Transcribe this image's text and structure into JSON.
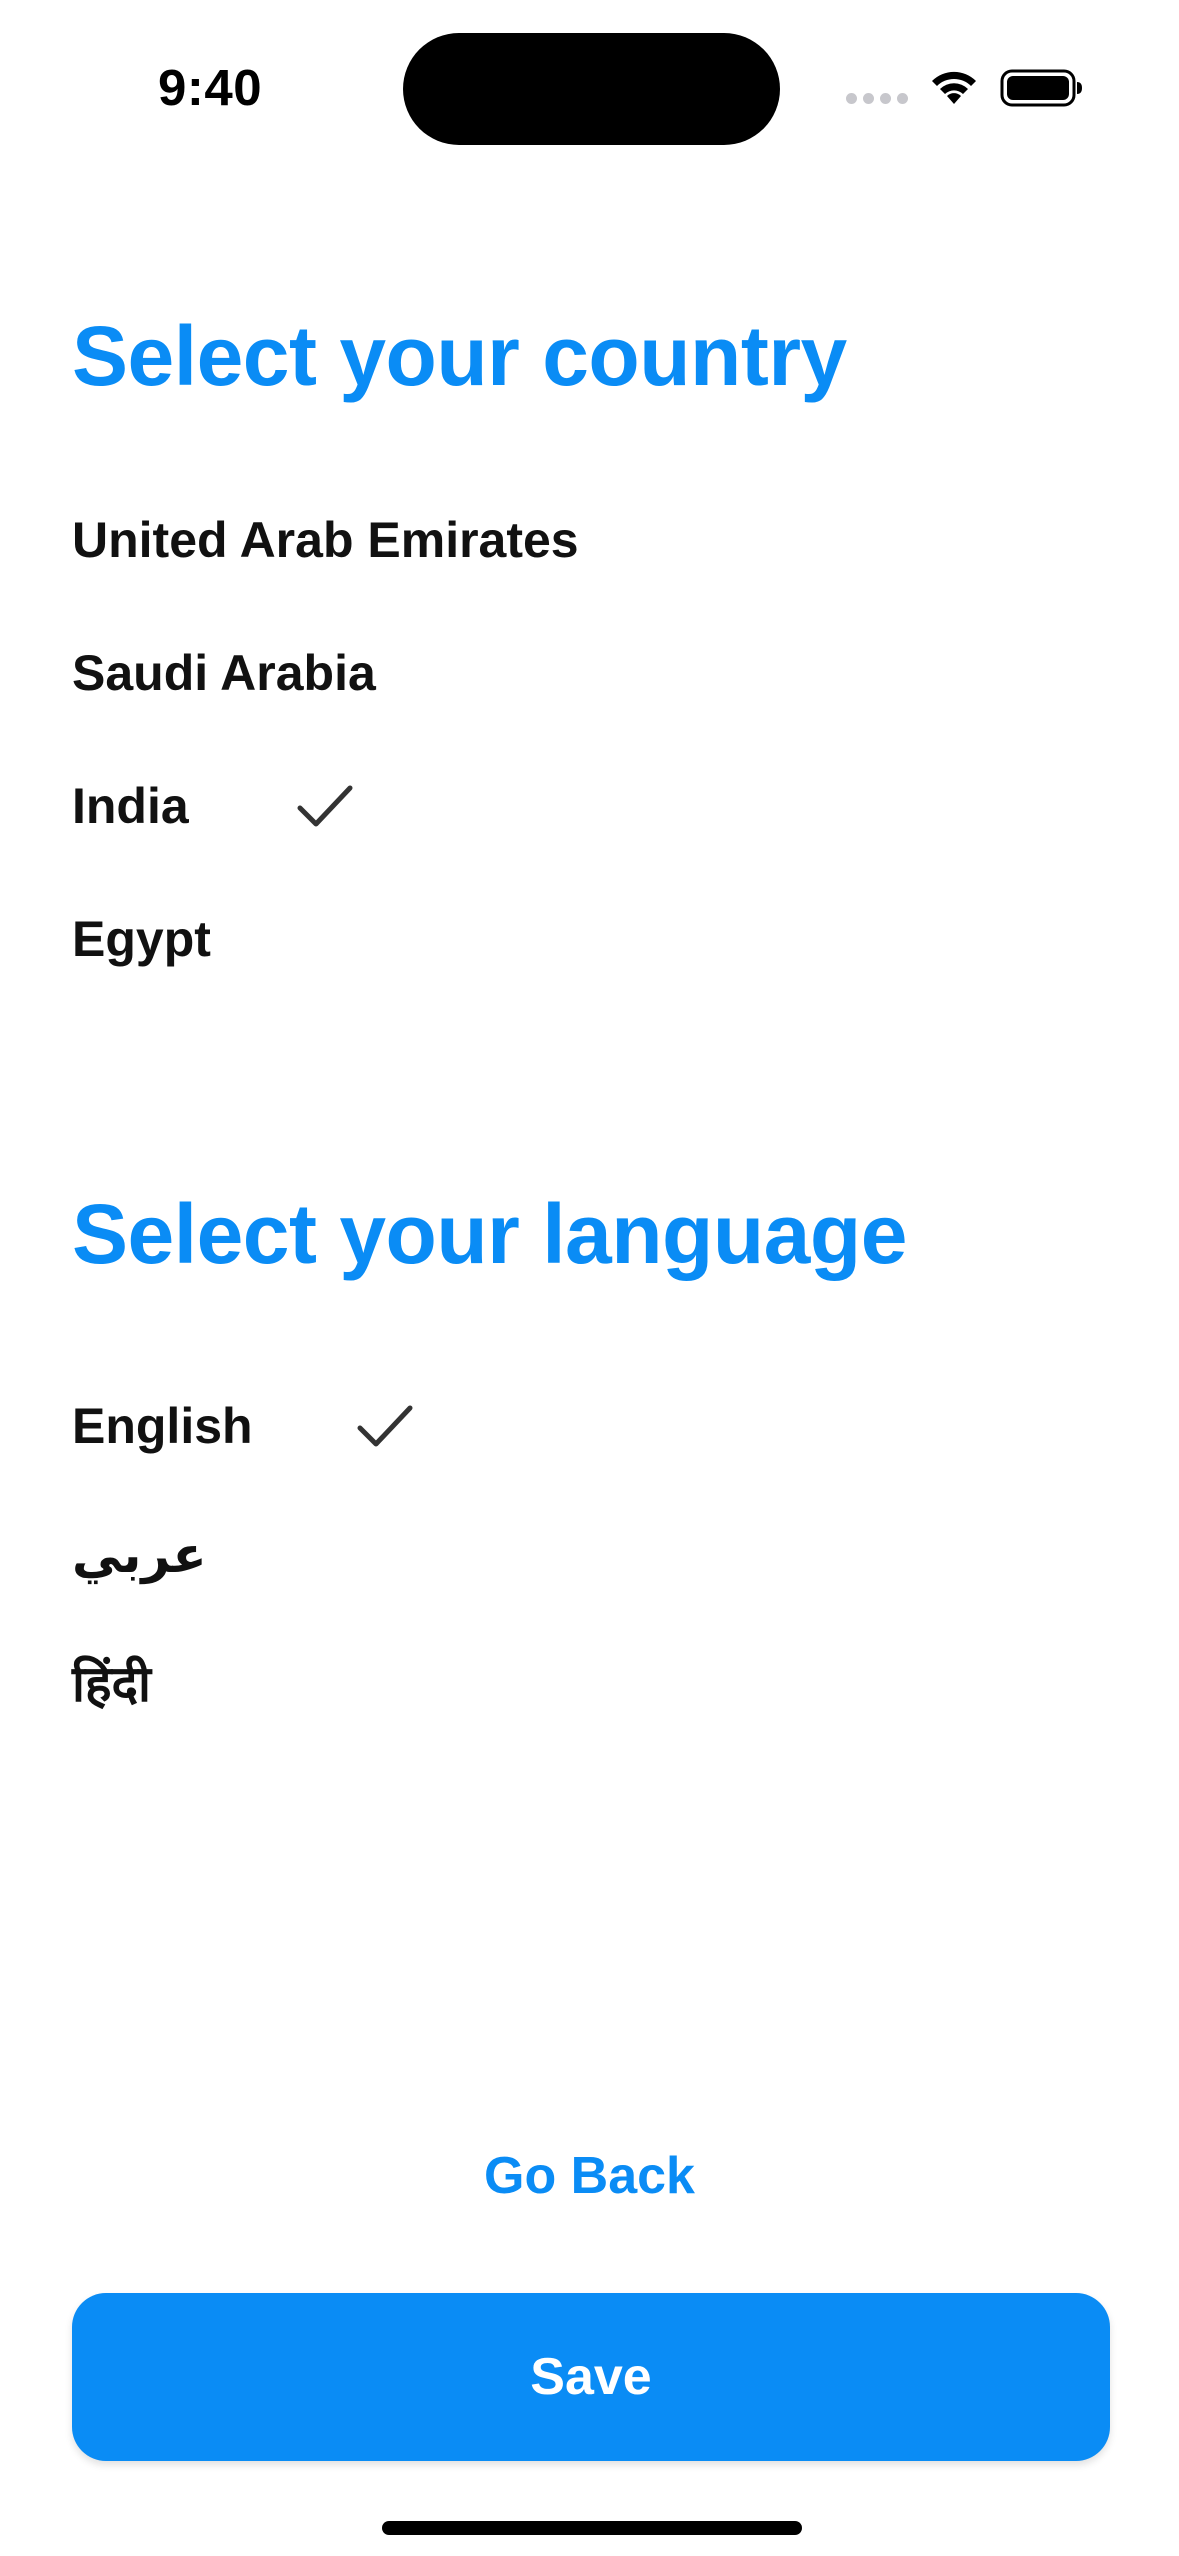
{
  "status_bar": {
    "time": "9:40",
    "icons": [
      "cellular-signal-icon",
      "wifi-icon",
      "battery-icon"
    ]
  },
  "country_section": {
    "title": "Select your country",
    "options": [
      {
        "label": "United Arab Emirates",
        "selected": false
      },
      {
        "label": "Saudi Arabia",
        "selected": false
      },
      {
        "label": "India",
        "selected": true
      },
      {
        "label": "Egypt",
        "selected": false
      }
    ]
  },
  "language_section": {
    "title": "Select your language",
    "options": [
      {
        "label": "English",
        "selected": true
      },
      {
        "label": "عربي",
        "selected": false
      },
      {
        "label": "हिंदी",
        "selected": false
      }
    ]
  },
  "actions": {
    "go_back_label": "Go Back",
    "save_label": "Save"
  },
  "colors": {
    "accent": "#0a8cf5",
    "text": "#111111",
    "checkmark": "#333333",
    "background": "#ffffff"
  }
}
